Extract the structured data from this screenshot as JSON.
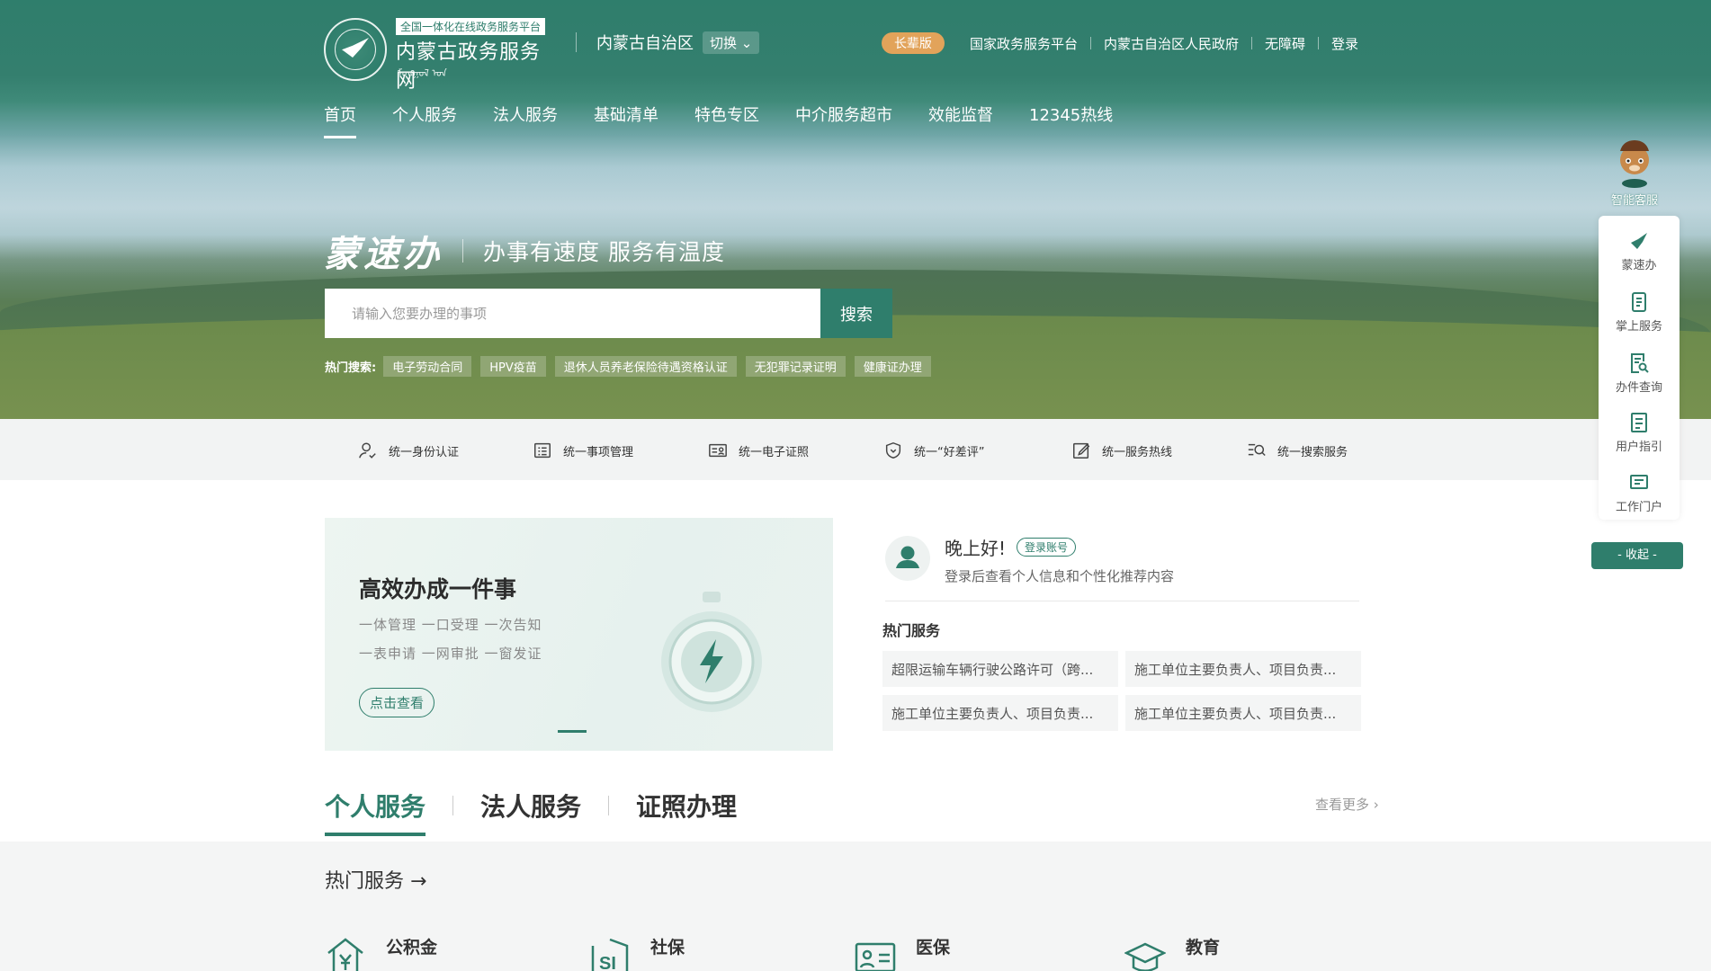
{
  "header": {
    "logo_tag": "全国一体化在线政务服务平台",
    "logo_title": "内蒙古政务服务网",
    "logo_mongolian": "ᠮᠣᠩᠭᠣᠯ ᠤᠨ",
    "region": "内蒙古自治区",
    "switch_label": "切换",
    "elder_label": "长辈版",
    "links": [
      "国家政务服务平台",
      "内蒙古自治区人民政府",
      "无障碍",
      "登录"
    ]
  },
  "nav": [
    "首页",
    "个人服务",
    "法人服务",
    "基础清单",
    "特色专区",
    "中介服务超市",
    "效能监督",
    "12345热线"
  ],
  "slogan": {
    "brand": "蒙速办",
    "text": "办事有速度  服务有温度"
  },
  "search": {
    "placeholder": "请输入您要办理的事项",
    "button": "搜索"
  },
  "hot_search": {
    "label": "热门搜索:",
    "tags": [
      "电子劳动合同",
      "HPV疫苗",
      "退休人员养老保险待遇资格认证",
      "无犯罪记录证明",
      "健康证办理"
    ]
  },
  "unified": [
    {
      "label": "统一身份认证",
      "icon": "user-check-icon"
    },
    {
      "label": "统一事项管理",
      "icon": "list-icon"
    },
    {
      "label": "统一电子证照",
      "icon": "id-card-icon"
    },
    {
      "label": "统一“好差评”",
      "icon": "shield-heart-icon"
    },
    {
      "label": "统一服务热线",
      "icon": "edit-icon"
    },
    {
      "label": "统一搜索服务",
      "icon": "search-list-icon"
    }
  ],
  "promo": {
    "title": "高效办成一件事",
    "line1": "一体管理 一口受理 一次告知",
    "line2": "一表申请 一网审批 一窗发证",
    "button": "点击查看"
  },
  "user": {
    "greeting": "晚上好!",
    "login_tag": "登录账号",
    "tip": "登录后查看个人信息和个性化推荐内容",
    "hot_title": "热门服务",
    "hot_services": [
      "超限运输车辆行驶公路许可（跨...",
      "施工单位主要负责人、项目负责...",
      "施工单位主要负责人、项目负责...",
      "施工单位主要负责人、项目负责..."
    ]
  },
  "service_tabs": [
    "个人服务",
    "法人服务",
    "证照办理"
  ],
  "more_label": "查看更多",
  "lower": {
    "heading": "热门服务",
    "categories": [
      "公积金",
      "社保",
      "医保",
      "教育"
    ]
  },
  "float": {
    "bot_label": "智能客服",
    "items": [
      "蒙速办",
      "掌上服务",
      "办件查询",
      "用户指引",
      "工作门户"
    ],
    "collapse": "- 收起 -"
  },
  "colors": {
    "primary": "#2f7e6c",
    "elder_badge": "#e2a35a"
  }
}
